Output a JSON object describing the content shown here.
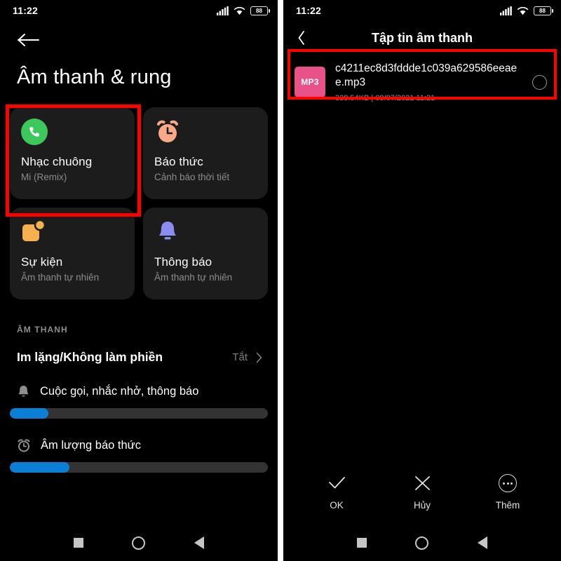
{
  "left_screen": {
    "status_bar": {
      "time": "11:22",
      "battery_level": "88",
      "signal_icon": "cellular-signal-icon",
      "wifi_icon": "wifi-icon",
      "battery_icon": "battery-icon"
    },
    "back_icon": "arrow-left-icon",
    "title": "Âm thanh & rung",
    "cards": [
      {
        "title": "Nhạc chuông",
        "subtitle": "Mi (Remix)",
        "icon": "phone-call-icon",
        "icon_color": "#3dc85b",
        "highlighted": true
      },
      {
        "title": "Báo thức",
        "subtitle": "Cảnh báo thời tiết",
        "icon": "alarm-clock-icon",
        "icon_color": "#f8a988",
        "highlighted": false
      },
      {
        "title": "Sự kiện",
        "subtitle": "Âm thanh tự nhiên",
        "icon": "calendar-event-icon",
        "icon_color": "#f5b14e",
        "highlighted": false
      },
      {
        "title": "Thông báo",
        "subtitle": "Âm thanh tự nhiên",
        "icon": "bell-notification-icon",
        "icon_color": "#8b8ef0",
        "highlighted": false
      }
    ],
    "section_label": "ÂM THANH",
    "dnd_row": {
      "label": "Im lặng/Không làm phiền",
      "value": "Tắt",
      "chevron_icon": "chevron-right-icon"
    },
    "volume_sliders": [
      {
        "label": "Cuộc gọi, nhắc nhở, thông báo",
        "icon": "bell-icon",
        "fill_percent": 15,
        "fill_color": "#0a7fd4"
      },
      {
        "label": "Âm lượng báo thức",
        "icon": "alarm-clock-icon",
        "fill_percent": 23,
        "fill_color": "#0a7fd4"
      }
    ],
    "nav_bar": {
      "recents_icon": "square-recents-icon",
      "home_icon": "circle-home-icon",
      "back_icon": "triangle-back-icon"
    }
  },
  "right_screen": {
    "status_bar": {
      "time": "11:22",
      "battery_level": "88",
      "signal_icon": "cellular-signal-icon",
      "wifi_icon": "wifi-icon",
      "battery_icon": "battery-icon"
    },
    "back_icon": "chevron-left-icon",
    "title": "Tập tin âm thanh",
    "file_item": {
      "badge_text": "MP3",
      "badge_color": "#e95289",
      "name": "c4211ec8d3fddde1c039a629586eeaee.mp3",
      "size": "338.54KB",
      "separator": "|",
      "date": "08/07/2021 11:21",
      "selected": false,
      "radio_icon": "radio-unselected-icon",
      "highlighted": true
    },
    "actions": [
      {
        "label": "OK",
        "icon": "check-icon"
      },
      {
        "label": "Hủy",
        "icon": "close-x-icon"
      },
      {
        "label": "Thêm",
        "icon": "more-dots-icon"
      }
    ],
    "nav_bar": {
      "recents_icon": "square-recents-icon",
      "home_icon": "circle-home-icon",
      "back_icon": "triangle-back-icon"
    }
  },
  "annotations": {
    "highlight_color": "#ff0000"
  }
}
